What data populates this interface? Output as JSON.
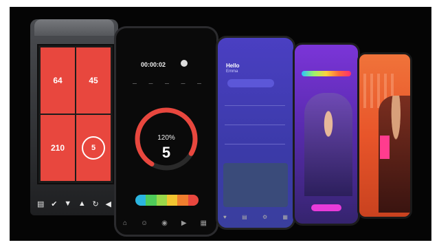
{
  "console": {
    "tiles": [
      "64",
      "45",
      "210",
      "5"
    ],
    "keys": [
      "▤",
      "✔",
      "▼",
      "▲",
      "↻",
      "◀"
    ]
  },
  "phone_black": {
    "timer": "00:00:02",
    "stats": [
      "—",
      "—",
      "—",
      "—",
      "—"
    ],
    "percent": "120%",
    "big_value": "5",
    "gauge_fraction": 0.75,
    "zone_colors": [
      "#2bb5e0",
      "#4ecb5a",
      "#9ad84a",
      "#f2c531",
      "#f07e2e",
      "#e8473e"
    ],
    "nav_icons": [
      "home-icon",
      "user-icon",
      "record-icon",
      "video-icon",
      "grid-icon"
    ]
  },
  "phone_blue": {
    "hello": "Hello",
    "name": "Emma",
    "nav_icons": [
      "pulse-icon",
      "chart-icon",
      "bike-icon",
      "grid-icon"
    ]
  },
  "colors": {
    "accent_red": "#e8473e",
    "purple": "#4a3fc2",
    "magenta": "#e83bd9",
    "orange": "#f0733a"
  }
}
